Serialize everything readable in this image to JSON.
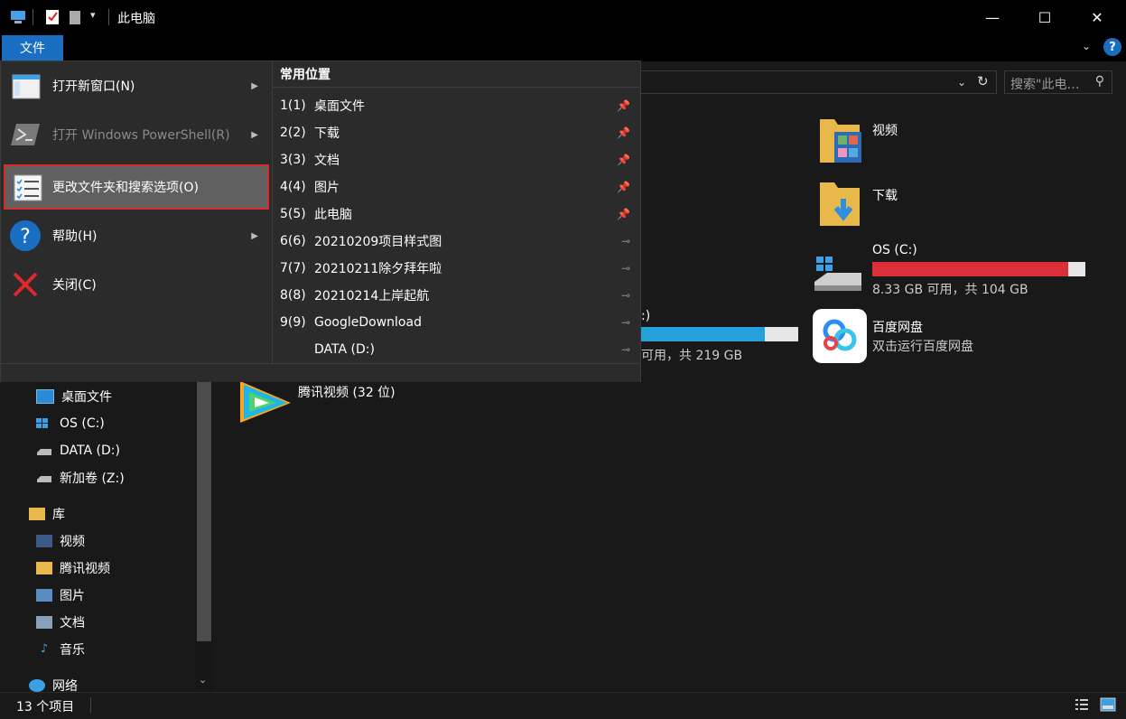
{
  "window": {
    "title": "此电脑",
    "minimize": "—",
    "maximize": "☐",
    "close": "✕"
  },
  "ribbon": {
    "file_tab": "文件",
    "help": "?",
    "collapse": "⌄"
  },
  "address": {
    "search_placeholder": "搜索\"此电…",
    "search_icon": "⚲",
    "refresh_icon": "↻",
    "dropdown_icon": "⌄"
  },
  "menu": {
    "items": [
      {
        "label": "打开新窗口(N)",
        "icon": "new-window-icon",
        "has_submenu": true,
        "enabled": true
      },
      {
        "label": "打开 Windows PowerShell(R)",
        "icon": "powershell-icon",
        "has_submenu": true,
        "enabled": false
      },
      {
        "label": "更改文件夹和搜索选项(O)",
        "icon": "folder-options-icon",
        "has_submenu": false,
        "enabled": true,
        "highlighted": true
      },
      {
        "label": "帮助(H)",
        "icon": "help-icon",
        "has_submenu": true,
        "enabled": true
      },
      {
        "label": "关闭(C)",
        "icon": "close-red-x-icon",
        "has_submenu": false,
        "enabled": true
      }
    ],
    "recent_title": "常用位置",
    "recent": [
      {
        "num": "1(1)",
        "label": "桌面文件",
        "pinned": true
      },
      {
        "num": "2(2)",
        "label": "下载",
        "pinned": true
      },
      {
        "num": "3(3)",
        "label": "文档",
        "pinned": true
      },
      {
        "num": "4(4)",
        "label": "图片",
        "pinned": true
      },
      {
        "num": "5(5)",
        "label": "此电脑",
        "pinned": true
      },
      {
        "num": "6(6)",
        "label": "20210209项目样式图",
        "pinned": false
      },
      {
        "num": "7(7)",
        "label": "20210211除夕拜年啦",
        "pinned": false
      },
      {
        "num": "8(8)",
        "label": "20210214上岸起航",
        "pinned": false
      },
      {
        "num": "9(9)",
        "label": "GoogleDownload",
        "pinned": false
      },
      {
        "num": "",
        "label": "DATA (D:)",
        "pinned": false
      }
    ]
  },
  "nav": {
    "items": [
      {
        "label": "桌面文件",
        "icon": "desktop-icon"
      },
      {
        "label": "OS (C:)",
        "icon": "windows-drive-icon"
      },
      {
        "label": "DATA (D:)",
        "icon": "drive-icon"
      },
      {
        "label": "新加卷 (Z:)",
        "icon": "drive-icon"
      },
      {
        "label": "库",
        "icon": "library-icon",
        "top_level": true
      },
      {
        "label": "视频",
        "icon": "video-icon"
      },
      {
        "label": "腾讯视频",
        "icon": "folder-icon"
      },
      {
        "label": "图片",
        "icon": "pictures-icon"
      },
      {
        "label": "文档",
        "icon": "documents-icon"
      },
      {
        "label": "音乐",
        "icon": "music-icon"
      },
      {
        "label": "网络",
        "icon": "network-icon",
        "top_level": true
      }
    ]
  },
  "content": {
    "folders": [
      {
        "label": "视频",
        "icon": "video-folder-icon"
      },
      {
        "label": "下载",
        "icon": "download-folder-icon"
      }
    ],
    "drives": [
      {
        "name": "OS (C:)",
        "info": "8.33 GB 可用，共 104 GB",
        "used_fraction": 0.92
      },
      {
        "name": ":)",
        "info": "可用，共 219 GB",
        "used_fraction": 0.79
      }
    ],
    "apps": [
      {
        "name": "百度网盘",
        "subtitle": "双击运行百度网盘",
        "icon": "baidu-netdisk-icon"
      },
      {
        "name": "腾讯视频 (32 位)",
        "icon": "tencent-video-icon"
      }
    ]
  },
  "status": {
    "count": "13 个项目"
  },
  "colors": {
    "accent": "#1a6ec2",
    "highlight_border": "#d92c2c",
    "drive_full": "#da2f36",
    "drive_normal": "#26a0da"
  }
}
